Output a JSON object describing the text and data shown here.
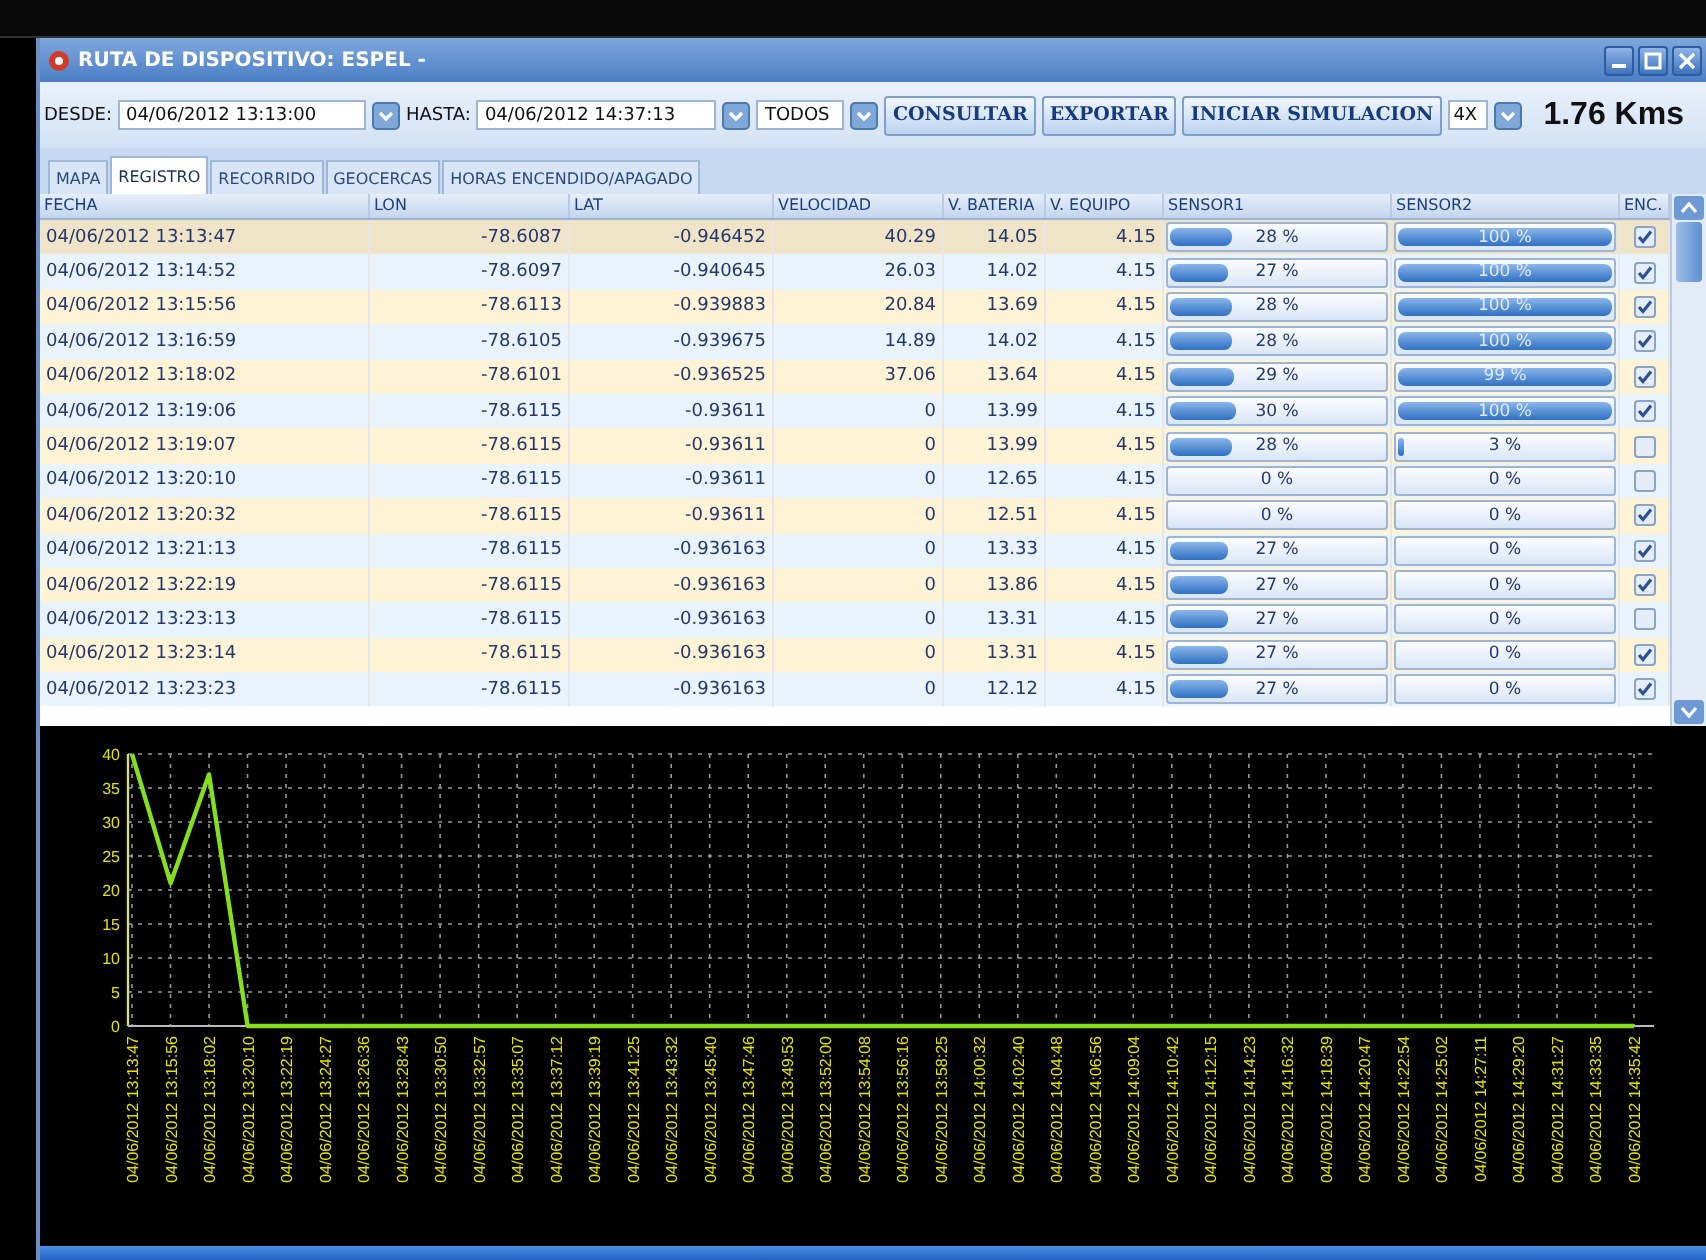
{
  "window": {
    "title": "RUTA DE DISPOSITIVO: ESPEL -"
  },
  "toolbar": {
    "from_label": "DESDE:",
    "from_value": "04/06/2012 13:13:00",
    "to_label": "HASTA:",
    "to_value": "04/06/2012 14:37:13",
    "filter_value": "TODOS",
    "buttons": [
      "CONSULTAR",
      "EXPORTAR",
      "INICIAR SIMULACION"
    ],
    "speed_value": "4X",
    "distance": "1.76 Kms"
  },
  "tabs": [
    {
      "label": "MAPA",
      "selected": false
    },
    {
      "label": "REGISTRO",
      "selected": true
    },
    {
      "label": "RECORRIDO",
      "selected": false
    },
    {
      "label": "GEOCERCAS",
      "selected": false
    },
    {
      "label": "HORAS ENCENDIDO/APAGADO",
      "selected": false
    }
  ],
  "table": {
    "columns": [
      "FECHA",
      "LON",
      "LAT",
      "VELOCIDAD",
      "V. BATERIA",
      "V. EQUIPO",
      "SENSOR1",
      "SENSOR2",
      "ENC."
    ],
    "rows": [
      {
        "selected": true,
        "cells": [
          "04/06/2012 13:13:47",
          "-78.6087",
          "-0.946452",
          "40.29",
          "14.05",
          "4.15"
        ],
        "sensor1": {
          "text": "28 %",
          "level": 0.28
        },
        "sensor2": {
          "text": "100 %",
          "level": 1
        },
        "enc_checked": true
      },
      {
        "selected": false,
        "cells": [
          "04/06/2012 13:14:52",
          "-78.6097",
          "-0.940645",
          "26.03",
          "14.02",
          "4.15"
        ],
        "sensor1": {
          "text": "27 %",
          "level": 0.27
        },
        "sensor2": {
          "text": "100 %",
          "level": 1
        },
        "enc_checked": true
      },
      {
        "selected": false,
        "cells": [
          "04/06/2012 13:15:56",
          "-78.6113",
          "-0.939883",
          "20.84",
          "13.69",
          "4.15"
        ],
        "sensor1": {
          "text": "28 %",
          "level": 0.28
        },
        "sensor2": {
          "text": "100 %",
          "level": 1
        },
        "enc_checked": true
      },
      {
        "selected": false,
        "cells": [
          "04/06/2012 13:16:59",
          "-78.6105",
          "-0.939675",
          "14.89",
          "14.02",
          "4.15"
        ],
        "sensor1": {
          "text": "28 %",
          "level": 0.28
        },
        "sensor2": {
          "text": "100 %",
          "level": 1
        },
        "enc_checked": true
      },
      {
        "selected": false,
        "cells": [
          "04/06/2012 13:18:02",
          "-78.6101",
          "-0.936525",
          "37.06",
          "13.64",
          "4.15"
        ],
        "sensor1": {
          "text": "29 %",
          "level": 0.29
        },
        "sensor2": {
          "text": "99 %",
          "level": 0.99
        },
        "enc_checked": true
      },
      {
        "selected": false,
        "cells": [
          "04/06/2012 13:19:06",
          "-78.6115",
          "-0.93611",
          "0",
          "13.99",
          "4.15"
        ],
        "sensor1": {
          "text": "30 %",
          "level": 0.3
        },
        "sensor2": {
          "text": "100 %",
          "level": 1
        },
        "enc_checked": true
      },
      {
        "selected": false,
        "cells": [
          "04/06/2012 13:19:07",
          "-78.6115",
          "-0.93611",
          "0",
          "13.99",
          "4.15"
        ],
        "sensor1": {
          "text": "28 %",
          "level": 0.28
        },
        "sensor2": {
          "text": "3 %",
          "level": 0.03
        },
        "enc_checked": false
      },
      {
        "selected": false,
        "cells": [
          "04/06/2012 13:20:10",
          "-78.6115",
          "-0.93611",
          "0",
          "12.65",
          "4.15"
        ],
        "sensor1": {
          "text": "0 %"
        },
        "sensor2": {
          "text": "0 %"
        },
        "enc_checked": false
      },
      {
        "selected": false,
        "cells": [
          "04/06/2012 13:20:32",
          "-78.6115",
          "-0.93611",
          "0",
          "12.51",
          "4.15"
        ],
        "sensor1": {
          "text": "0 %"
        },
        "sensor2": {
          "text": "0 %"
        },
        "enc_checked": true
      },
      {
        "selected": false,
        "cells": [
          "04/06/2012 13:21:13",
          "-78.6115",
          "-0.936163",
          "0",
          "13.33",
          "4.15"
        ],
        "sensor1": {
          "text": "27 %",
          "level": 0.27
        },
        "sensor2": {
          "text": "0 %"
        },
        "enc_checked": true
      },
      {
        "selected": false,
        "cells": [
          "04/06/2012 13:22:19",
          "-78.6115",
          "-0.936163",
          "0",
          "13.86",
          "4.15"
        ],
        "sensor1": {
          "text": "27 %",
          "level": 0.27
        },
        "sensor2": {
          "text": "0 %"
        },
        "enc_checked": true
      },
      {
        "selected": false,
        "cells": [
          "04/06/2012 13:23:13",
          "-78.6115",
          "-0.936163",
          "0",
          "13.31",
          "4.15"
        ],
        "sensor1": {
          "text": "27 %",
          "level": 0.27
        },
        "sensor2": {
          "text": "0 %"
        },
        "enc_checked": false
      },
      {
        "selected": false,
        "cells": [
          "04/06/2012 13:23:14",
          "-78.6115",
          "-0.936163",
          "0",
          "13.31",
          "4.15"
        ],
        "sensor1": {
          "text": "27 %",
          "level": 0.27
        },
        "sensor2": {
          "text": "0 %"
        },
        "enc_checked": true
      },
      {
        "selected": false,
        "cells": [
          "04/06/2012 13:23:23",
          "-78.6115",
          "-0.936163",
          "0",
          "12.12",
          "4.15"
        ],
        "sensor1": {
          "text": "27 %",
          "level": 0.27
        },
        "sensor2": {
          "text": "0 %"
        },
        "enc_checked": true
      }
    ]
  },
  "chart": {
    "chart_data": {
      "type": "line",
      "grid": true,
      "ylim": [
        0,
        40
      ],
      "yticks": [
        0,
        5,
        10,
        15,
        20,
        25,
        30,
        35,
        40
      ],
      "categories": [
        "04/06/2012 13:13:47",
        "04/06/2012 13:15:56",
        "04/06/2012 13:18:02",
        "04/06/2012 13:20:10",
        "04/06/2012 13:22:19",
        "04/06/2012 13:24:27",
        "04/06/2012 13:26:36",
        "04/06/2012 13:28:43",
        "04/06/2012 13:30:50",
        "04/06/2012 13:32:57",
        "04/06/2012 13:35:07",
        "04/06/2012 13:37:12",
        "04/06/2012 13:39:19",
        "04/06/2012 13:41:25",
        "04/06/2012 13:43:32",
        "04/06/2012 13:45:40",
        "04/06/2012 13:47:46",
        "04/06/2012 13:49:53",
        "04/06/2012 13:52:00",
        "04/06/2012 13:54:08",
        "04/06/2012 13:56:16",
        "04/06/2012 13:58:25",
        "04/06/2012 14:00:32",
        "04/06/2012 14:02:40",
        "04/06/2012 14:04:48",
        "04/06/2012 14:06:56",
        "04/06/2012 14:09:04",
        "04/06/2012 14:10:42",
        "04/06/2012 14:12:15",
        "04/06/2012 14:14:23",
        "04/06/2012 14:16:32",
        "04/06/2012 14:18:39",
        "04/06/2012 14:20:47",
        "04/06/2012 14:22:54",
        "04/06/2012 14:25:02",
        "04/06/2012 14:27:11",
        "04/06/2012 14:29:20",
        "04/06/2012 14:31:27",
        "04/06/2012 14:33:35",
        "04/06/2012 14:35:42"
      ],
      "values": [
        40,
        21,
        37,
        0,
        0,
        0,
        0,
        0,
        0,
        0,
        0,
        0,
        0,
        0,
        0,
        0,
        0,
        0,
        0,
        0,
        0,
        0,
        0,
        0,
        0,
        0,
        0,
        0,
        0,
        0,
        0,
        0,
        0,
        0,
        0,
        0,
        0,
        0,
        0,
        0
      ]
    }
  }
}
